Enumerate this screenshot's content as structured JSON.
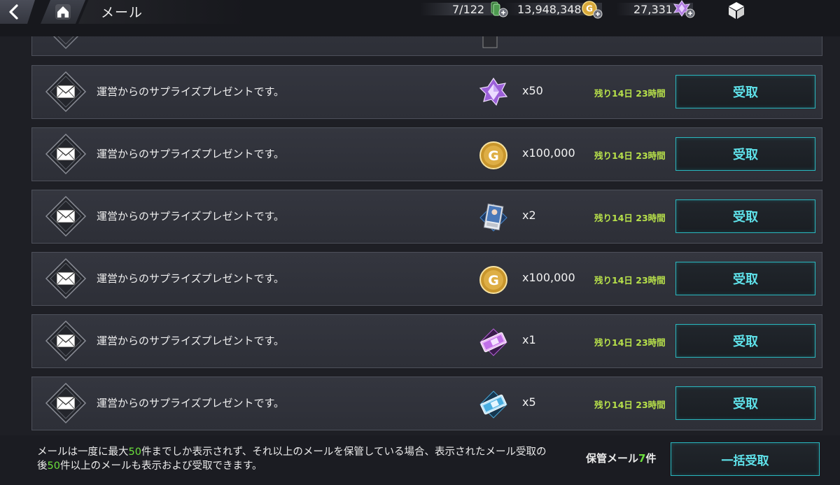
{
  "header": {
    "title": "メール",
    "stamina": "7/122",
    "gold": "13,948,348",
    "gems": "27,331"
  },
  "mail": {
    "rows": [
      {
        "subject": "運営からのサプライズプレゼントです。",
        "item_icon": "gem-icon",
        "quantity": "x50",
        "remaining": "残り14日 23時間",
        "button": "受取"
      },
      {
        "subject": "運営からのサプライズプレゼントです。",
        "item_icon": "gold-coin-icon",
        "quantity": "x100,000",
        "remaining": "残り14日 23時間",
        "button": "受取"
      },
      {
        "subject": "運営からのサプライズプレゼントです。",
        "item_icon": "character-card-icon",
        "quantity": "x2",
        "remaining": "残り14日 23時間",
        "button": "受取"
      },
      {
        "subject": "運営からのサプライズプレゼントです。",
        "item_icon": "gold-coin-icon",
        "quantity": "x100,000",
        "remaining": "残り14日 23時間",
        "button": "受取"
      },
      {
        "subject": "運営からのサプライズプレゼントです。",
        "item_icon": "pink-ticket-icon",
        "quantity": "x1",
        "remaining": "残り14日 23時間",
        "button": "受取"
      },
      {
        "subject": "運営からのサプライズプレゼントです。",
        "item_icon": "blue-ticket-icon",
        "quantity": "x5",
        "remaining": "残り14日 23時間",
        "button": "受取"
      }
    ]
  },
  "footer": {
    "note_part1": "メールは一度に最大",
    "note_num1": "50",
    "note_part2": "件までしか表示されず、それ以上のメールを保管している場合、表示されたメール受取の後",
    "note_num2": "50",
    "note_part3": "件以上のメールも表示および受取できます。",
    "stored_label": "保管メール",
    "stored_count": "7",
    "stored_unit": "件",
    "claim_all": "一括受取"
  },
  "colors": {
    "accent": "#29b7be",
    "button_text": "#5fe2ea",
    "time_text": "#b7e04a",
    "highlight": "#6be03c",
    "row_bg": "#34363f"
  }
}
